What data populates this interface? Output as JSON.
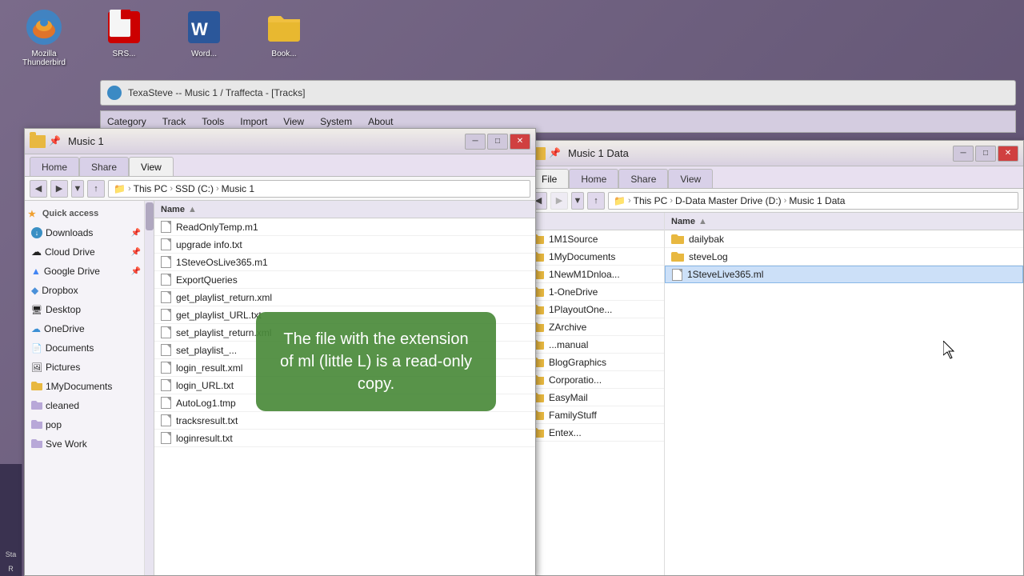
{
  "desktop": {
    "background": "#6b5b7b"
  },
  "desktop_icons": [
    {
      "id": "thunderbird",
      "label": "Mozilla\nThunderbird",
      "icon": "🦅",
      "color": "#4a90d9"
    },
    {
      "id": "acrobat",
      "label": "SRS...",
      "icon": "📄",
      "color": "#cc0000"
    },
    {
      "id": "word",
      "label": "Word...",
      "icon": "📝",
      "color": "#2b579a"
    },
    {
      "id": "folder1",
      "label": "Book...",
      "icon": "📁",
      "color": "#e8b840"
    }
  ],
  "music_player": {
    "title": "TexaSteve -- Music 1 / Traffecta - [Tracks]"
  },
  "menu_bar": {
    "items": [
      "Category",
      "Track",
      "Tools",
      "Import",
      "View",
      "System",
      "About"
    ]
  },
  "explorer_left": {
    "title": "Music 1",
    "title_bar_path": "Music 1",
    "tabs": [
      "Home",
      "Share",
      "View"
    ],
    "active_tab": "Home",
    "address_path": [
      "This PC",
      "SSD (C:)",
      "Music 1"
    ],
    "sidebar_items": [
      {
        "id": "quick-access",
        "label": "Quick access",
        "type": "section",
        "icon": "⭐"
      },
      {
        "id": "downloads",
        "label": "Downloads",
        "type": "item",
        "pinned": true,
        "icon": "dl"
      },
      {
        "id": "cloud-drive",
        "label": "Cloud Drive",
        "type": "item",
        "pinned": true,
        "icon": "cloud"
      },
      {
        "id": "google-drive",
        "label": "Google Drive",
        "type": "item",
        "pinned": true,
        "icon": "gdrive"
      },
      {
        "id": "dropbox",
        "label": "Dropbox",
        "type": "item",
        "pinned": false,
        "icon": "dropbox"
      },
      {
        "id": "desktop",
        "label": "Desktop",
        "type": "item",
        "pinned": false,
        "icon": "desktop"
      },
      {
        "id": "onedrive",
        "label": "OneDrive",
        "type": "item",
        "pinned": false,
        "icon": "onedrive"
      },
      {
        "id": "documents",
        "label": "Documents",
        "type": "item",
        "pinned": false,
        "icon": "docs"
      },
      {
        "id": "pictures",
        "label": "Pictures",
        "type": "item",
        "pinned": false,
        "icon": "pics"
      },
      {
        "id": "1mydocuments",
        "label": "1MyDocuments",
        "type": "item",
        "pinned": false,
        "icon": "folder"
      },
      {
        "id": "cleaned",
        "label": "cleaned",
        "type": "item",
        "pinned": false,
        "icon": "folder"
      },
      {
        "id": "pop",
        "label": "pop",
        "type": "item",
        "pinned": false,
        "icon": "folder"
      },
      {
        "id": "sve-work",
        "label": "Sve Work",
        "type": "item",
        "pinned": false,
        "icon": "folder"
      }
    ],
    "files": [
      {
        "name": "ReadOnlyTemp.m1",
        "type": "file"
      },
      {
        "name": "upgrade info.txt",
        "type": "file"
      },
      {
        "name": "1SteveOsLive365.m1",
        "type": "file"
      },
      {
        "name": "ExportQueries",
        "type": "file"
      },
      {
        "name": "get_playlist_return.xml",
        "type": "file"
      },
      {
        "name": "get_playlist_URL.txt",
        "type": "file"
      },
      {
        "name": "set_playlist_return.xml",
        "type": "file"
      },
      {
        "name": "set_playlist_...",
        "type": "file"
      },
      {
        "name": "login_result.xml",
        "type": "file"
      },
      {
        "name": "login_URL.txt",
        "type": "file"
      },
      {
        "name": "AutoLog1.tmp",
        "type": "file"
      },
      {
        "name": "tracksresult.txt",
        "type": "file"
      },
      {
        "name": "loginresult.txt",
        "type": "file"
      }
    ],
    "column_header": "Name"
  },
  "explorer_right": {
    "title": "Music 1 Data",
    "tabs": [
      "File",
      "Home",
      "Share",
      "View"
    ],
    "active_tab": "File",
    "address_path": [
      "This PC",
      "D-Data Master Drive (D:)",
      "Music 1 Data"
    ],
    "folders_left": [
      {
        "name": "1M1Source",
        "type": "folder"
      },
      {
        "name": "1MyDocuments",
        "type": "folder"
      },
      {
        "name": "1NewM1Dnloa...",
        "type": "folder"
      },
      {
        "name": "1-OneDrive",
        "type": "folder"
      },
      {
        "name": "1PlayoutOne...",
        "type": "folder"
      },
      {
        "name": "ZArchive",
        "type": "folder"
      },
      {
        "name": "...manual",
        "type": "folder"
      },
      {
        "name": "BlogGraphics",
        "type": "folder"
      },
      {
        "name": "Corporatio...",
        "type": "folder"
      },
      {
        "name": "EasyMail",
        "type": "folder"
      },
      {
        "name": "FamilyStuff",
        "type": "folder"
      },
      {
        "name": "Entex...",
        "type": "folder"
      }
    ],
    "files_right": [
      {
        "name": "dailybak",
        "type": "folder"
      },
      {
        "name": "steveLog",
        "type": "folder"
      },
      {
        "name": "1SteveLive365.ml",
        "type": "file",
        "selected": true
      }
    ],
    "column_header": "Name"
  },
  "tooltip": {
    "text": "The file with the extension of ml (little L) is a read-only copy."
  },
  "taskbar": {
    "label_left": "Sta",
    "label_right": "R"
  },
  "icons": {
    "back": "◀",
    "forward": "▶",
    "up": "↑",
    "dropdown": "▼",
    "minimize": "─",
    "maximize": "□",
    "close": "✕",
    "star": "★",
    "pin": "📌"
  }
}
